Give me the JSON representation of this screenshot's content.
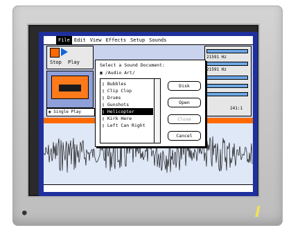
{
  "menubar": {
    "apple": "",
    "items": [
      "File",
      "Edit",
      "View",
      "Effects",
      "Setup",
      "Sounds"
    ]
  },
  "toolbar": {
    "stop": "Stop",
    "play": "Play"
  },
  "left": {
    "single_play": "Single Play"
  },
  "right": {
    "rate_1": "21591 Hz",
    "rate_2": "21591 Hz",
    "ratio": "241:1"
  },
  "dialog": {
    "title": "Select a Sound Document:",
    "folder": "/Audio Art/",
    "files": [
      "Bubbles",
      "Clip Clop",
      "Drums",
      "Gunshots",
      "Helicopter",
      "Kirk Here",
      "Left Can Right"
    ],
    "selected_index": 4,
    "buttons": {
      "disk": "Disk",
      "open": "Open",
      "close": "Close",
      "cancel": "Cancel"
    }
  },
  "colors": {
    "accent_orange": "#ff6a00",
    "screen_frame": "#1f2f9e"
  }
}
